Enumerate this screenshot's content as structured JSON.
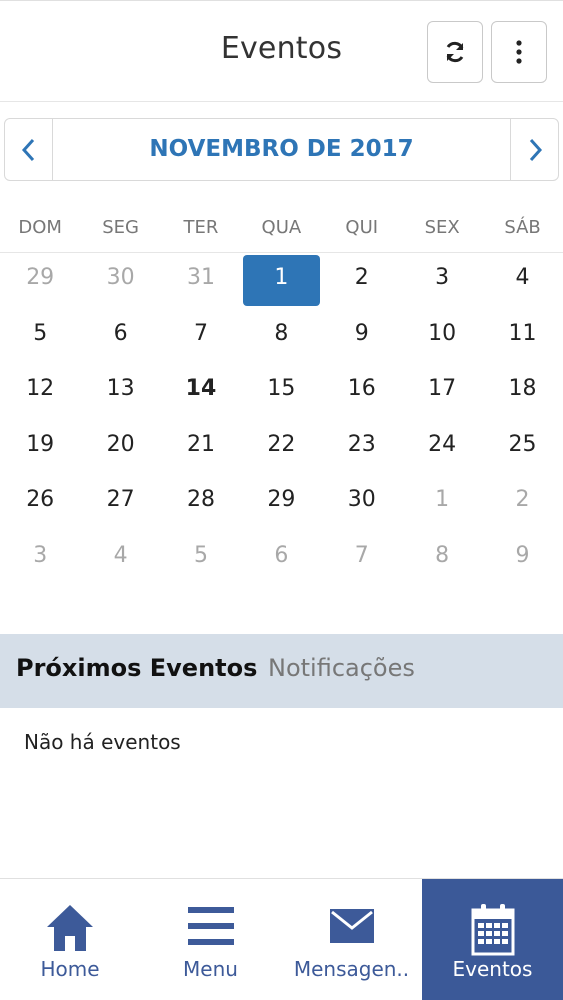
{
  "header": {
    "title": "Eventos",
    "refresh_icon": "refresh-icon",
    "more_icon": "more-vertical-icon"
  },
  "month": {
    "label": "NOVEMBRO DE 2017",
    "prev_icon": "chevron-left-icon",
    "next_icon": "chevron-right-icon",
    "accent": "#2e75b6"
  },
  "weekdays": [
    "DOM",
    "SEG",
    "TER",
    "QUA",
    "QUI",
    "SEX",
    "SÁB"
  ],
  "calendar": {
    "selected_day": "1",
    "today_day": "14",
    "weeks": [
      [
        {
          "d": "29",
          "muted": true
        },
        {
          "d": "30",
          "muted": true
        },
        {
          "d": "31",
          "muted": true
        },
        {
          "d": "1"
        },
        {
          "d": "2"
        },
        {
          "d": "3"
        },
        {
          "d": "4"
        }
      ],
      [
        {
          "d": "5"
        },
        {
          "d": "6"
        },
        {
          "d": "7"
        },
        {
          "d": "8"
        },
        {
          "d": "9"
        },
        {
          "d": "10"
        },
        {
          "d": "11"
        }
      ],
      [
        {
          "d": "12"
        },
        {
          "d": "13"
        },
        {
          "d": "14"
        },
        {
          "d": "15"
        },
        {
          "d": "16"
        },
        {
          "d": "17"
        },
        {
          "d": "18"
        }
      ],
      [
        {
          "d": "19"
        },
        {
          "d": "20"
        },
        {
          "d": "21"
        },
        {
          "d": "22"
        },
        {
          "d": "23"
        },
        {
          "d": "24"
        },
        {
          "d": "25"
        }
      ],
      [
        {
          "d": "26"
        },
        {
          "d": "27"
        },
        {
          "d": "28"
        },
        {
          "d": "29"
        },
        {
          "d": "30"
        },
        {
          "d": "1",
          "muted": true
        },
        {
          "d": "2",
          "muted": true
        }
      ],
      [
        {
          "d": "3",
          "muted": true
        },
        {
          "d": "4",
          "muted": true
        },
        {
          "d": "5",
          "muted": true
        },
        {
          "d": "6",
          "muted": true
        },
        {
          "d": "7",
          "muted": true
        },
        {
          "d": "8",
          "muted": true
        },
        {
          "d": "9",
          "muted": true
        }
      ]
    ]
  },
  "tabs": {
    "upcoming": "Próximos Eventos",
    "notifications": "Notificações",
    "tab_bg": "#d5dee8"
  },
  "events": {
    "empty_text": "Não há eventos"
  },
  "bottom_nav": {
    "home": "Home",
    "menu": "Menu",
    "messages": "Mensagen..",
    "events": "Eventos",
    "active_bg": "#3b5998",
    "icon_color": "#3d5a99"
  }
}
